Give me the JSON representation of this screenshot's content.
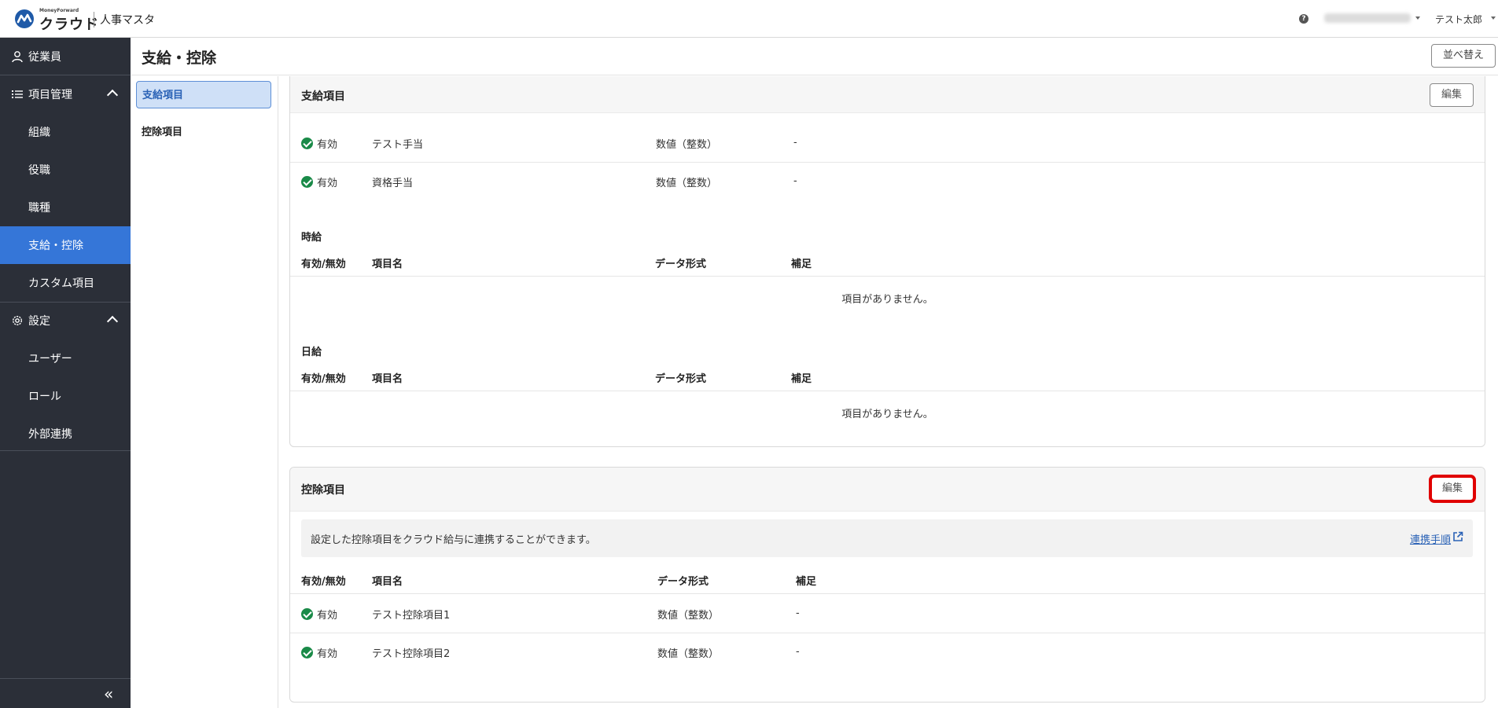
{
  "header": {
    "logo_small": "MoneyForward",
    "logo_text": "クラウド",
    "product_name": "人事マスタ",
    "user_name": "テスト太郎"
  },
  "sidebar": {
    "items": [
      {
        "label": "従業員"
      },
      {
        "label": "項目管理"
      },
      {
        "label": "組織"
      },
      {
        "label": "役職"
      },
      {
        "label": "職種"
      },
      {
        "label": "支給・控除"
      },
      {
        "label": "カスタム項目"
      },
      {
        "label": "設定"
      },
      {
        "label": "ユーザー"
      },
      {
        "label": "ロール"
      },
      {
        "label": "外部連携"
      }
    ],
    "collapse_label": "«"
  },
  "page": {
    "title": "支給・控除",
    "sort_label": "並べ替え"
  },
  "subnav": {
    "items": [
      {
        "label": "支給項目"
      },
      {
        "label": "控除項目"
      }
    ]
  },
  "payments": {
    "title": "支給項目",
    "edit_label": "編集",
    "rows": [
      {
        "status": "有効",
        "name": "テスト手当",
        "type": "数値（整数）",
        "note": "-"
      },
      {
        "status": "有効",
        "name": "資格手当",
        "type": "数値（整数）",
        "note": "-"
      }
    ],
    "hourly": {
      "label": "時給",
      "empty": "項目がありません。"
    },
    "daily": {
      "label": "日給",
      "empty": "項目がありません。"
    }
  },
  "columns": {
    "status": "有効/無効",
    "name": "項目名",
    "type": "データ形式",
    "note": "補足"
  },
  "deductions": {
    "title": "控除項目",
    "edit_label": "編集",
    "info_text": "設定した控除項目をクラウド給与に連携することができます。",
    "info_link": "連携手順",
    "rows": [
      {
        "status": "有効",
        "name": "テスト控除項目1",
        "type": "数値（整数）",
        "note": "-"
      },
      {
        "status": "有効",
        "name": "テスト控除項目2",
        "type": "数値（整数）",
        "note": "-"
      }
    ]
  },
  "colors": {
    "sidebar_bg": "#2b2f38",
    "active_bg": "#3576d8",
    "valid_green": "#1a8a48",
    "highlight_red": "#e00000",
    "link_blue": "#2a62b6"
  }
}
